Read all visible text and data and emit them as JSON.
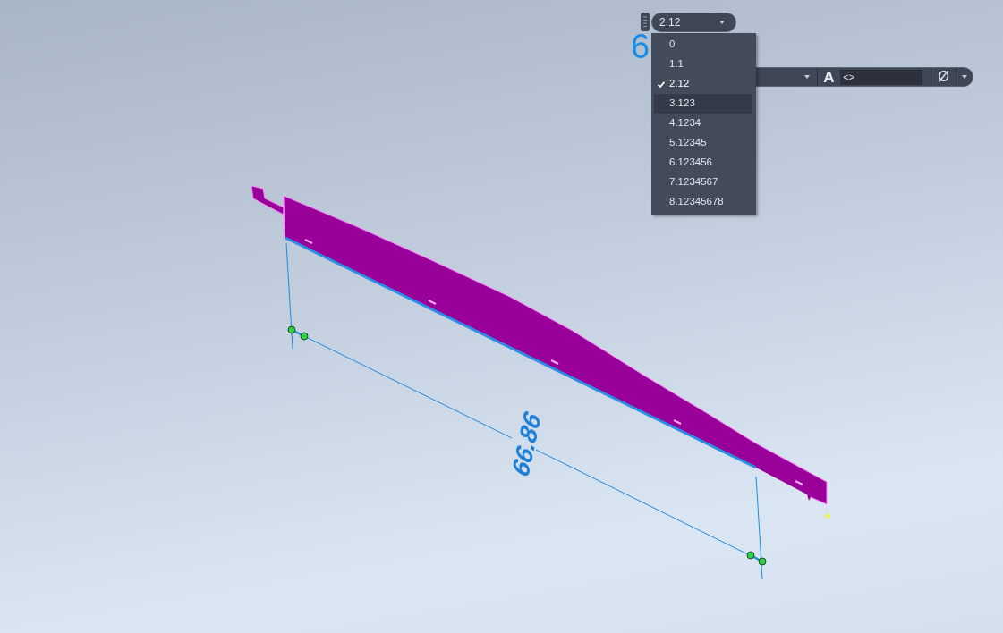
{
  "precision_control": {
    "value": "2.12"
  },
  "dimension_edit": {
    "visible_value": "6"
  },
  "precision_menu": {
    "items": [
      {
        "label": "0",
        "selected": false,
        "hovered": false
      },
      {
        "label": "1.1",
        "selected": false,
        "hovered": false
      },
      {
        "label": "2.12",
        "selected": true,
        "hovered": false
      },
      {
        "label": "3.123",
        "selected": false,
        "hovered": true
      },
      {
        "label": "4.1234",
        "selected": false,
        "hovered": false
      },
      {
        "label": "5.12345",
        "selected": false,
        "hovered": false
      },
      {
        "label": "6.123456",
        "selected": false,
        "hovered": false
      },
      {
        "label": "7.1234567",
        "selected": false,
        "hovered": false
      },
      {
        "label": "8.12345678",
        "selected": false,
        "hovered": false
      }
    ]
  },
  "dimension_toolbar": {
    "text_style_label": "A",
    "text_field": {
      "value": "<>"
    },
    "symbol_button": {
      "label": "Ø"
    }
  },
  "dimension": {
    "value": "66.86"
  }
}
